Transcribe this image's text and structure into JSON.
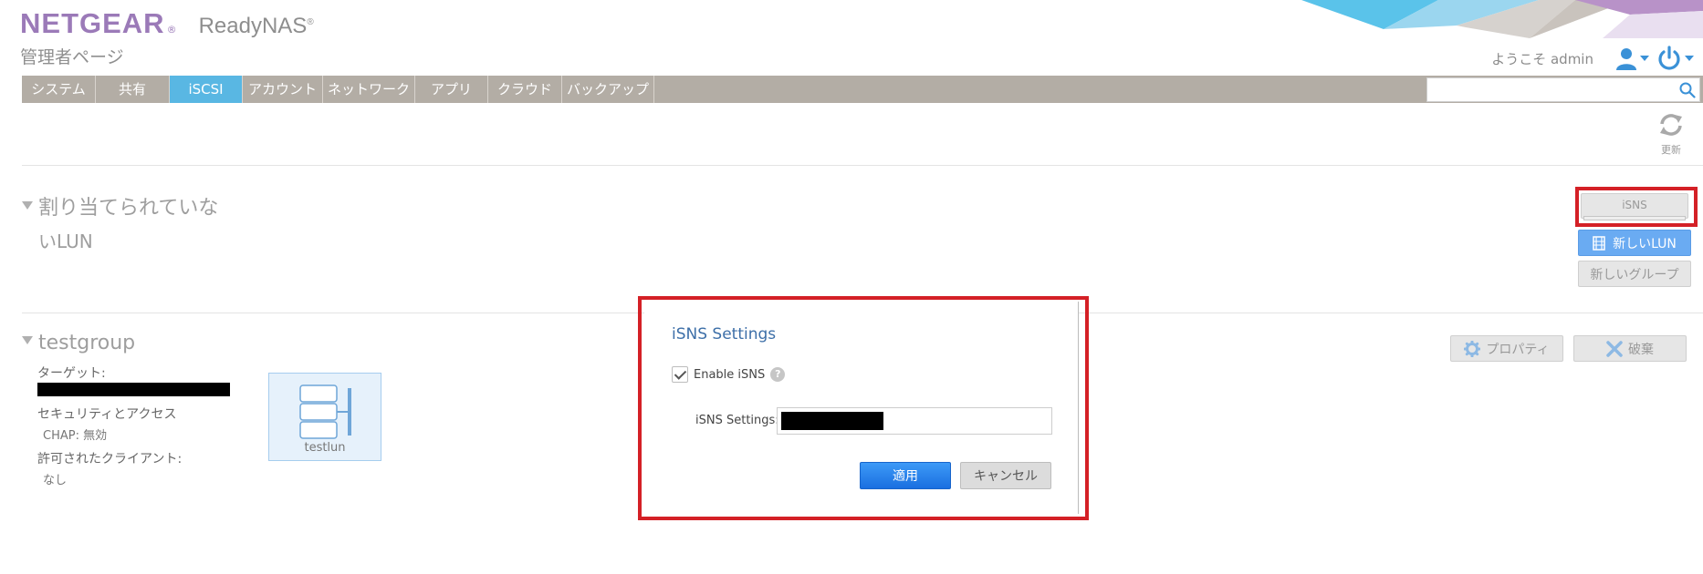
{
  "header": {
    "logo": "NETGEAR",
    "logo_mark": "®",
    "product": "ReadyNAS",
    "product_mark": "®",
    "subtitle": "管理者ページ",
    "welcome": "ようこそ admin"
  },
  "nav": {
    "tabs": [
      {
        "label": "システム"
      },
      {
        "label": "共有"
      },
      {
        "label": "iSCSI"
      },
      {
        "label": "アカウント"
      },
      {
        "label": "ネットワーク"
      },
      {
        "label": "アプリ"
      },
      {
        "label": "クラウド"
      },
      {
        "label": "バックアップ"
      }
    ],
    "active_tab": "iSCSI",
    "search_value": ""
  },
  "toolbar": {
    "refresh_label": "更新"
  },
  "unassigned": {
    "title_line1": "割り当てられていな",
    "title_line2": "いLUN",
    "isns_button": "iSNS",
    "new_lun_button": "新しいLUN",
    "new_group_button": "新しいグループ"
  },
  "group": {
    "name": "testgroup",
    "target_label": "ターゲット:",
    "security_label": "セキュリティとアクセス",
    "chap_value": "CHAP: 無効",
    "clients_label": "許可されたクライアント:",
    "clients_value": "なし",
    "lun_name": "testlun",
    "properties_button": "プロパティ",
    "destroy_button": "破棄"
  },
  "dialog": {
    "title": "iSNS Settings",
    "enable_label": "Enable iSNS",
    "enable_checked": true,
    "help_glyph": "?",
    "settings_label": "iSNS Settings:",
    "apply_button": "適用",
    "cancel_button": "キャンセル"
  },
  "colors": {
    "brand": "#9b7ab8",
    "nav_bg": "#b3ada5",
    "nav_active": "#59b7e3",
    "highlight": "#d42026",
    "primary_button": "#1a6fe0"
  }
}
